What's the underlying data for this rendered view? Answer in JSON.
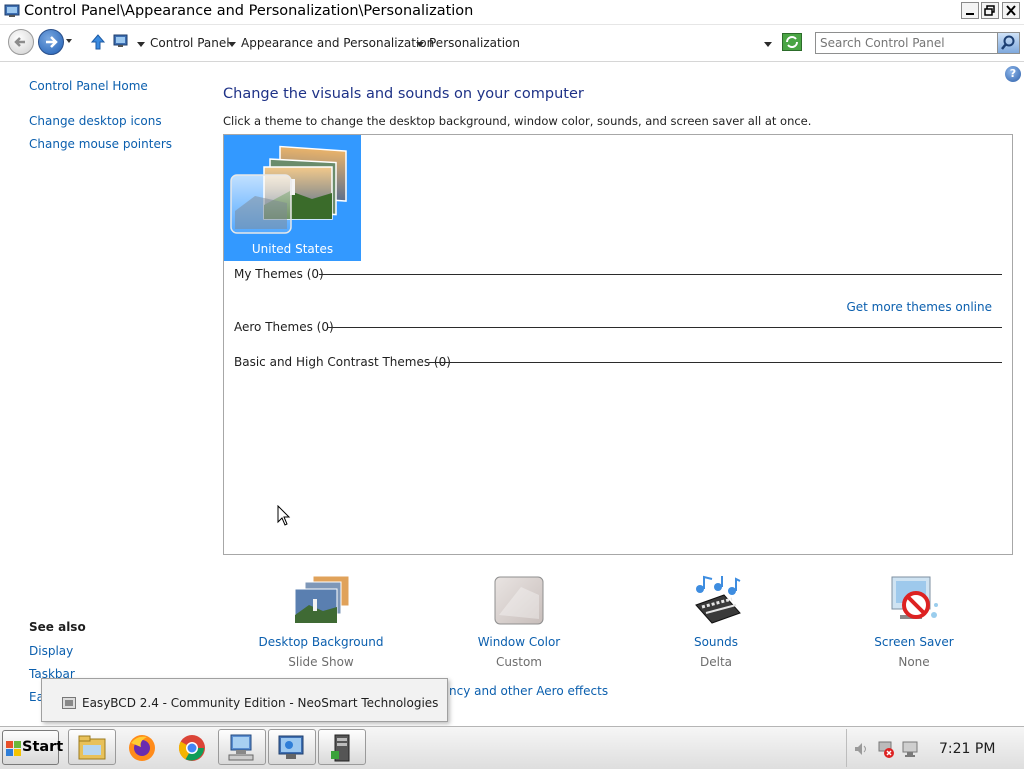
{
  "window": {
    "title": "Control Panel\\Appearance and Personalization\\Personalization",
    "minimize_icon": "minimize-icon",
    "restore_icon": "restore-icon",
    "close_icon": "close-icon"
  },
  "address": {
    "crumbs": [
      "Control Panel",
      "Appearance and Personalization",
      "Personalization"
    ],
    "search_placeholder": "Search Control Panel"
  },
  "left_pane": {
    "home": "Control Panel Home",
    "links": [
      "Change desktop icons",
      "Change mouse pointers"
    ],
    "see_also_title": "See also",
    "see_also": [
      "Display",
      "Taskbar",
      "Ea"
    ]
  },
  "main": {
    "title": "Change the visuals and sounds on your computer",
    "subtitle": "Click a theme to change the desktop background, window color, sounds, and screen saver all at once.",
    "selected_theme": "United States",
    "groups": {
      "my_themes": "My Themes (0)",
      "aero_themes": "Aero Themes (0)",
      "basic_themes": "Basic and High Contrast Themes (0)"
    },
    "more_themes_link": "Get more themes online"
  },
  "settings": [
    {
      "name": "Desktop Background",
      "value": "Slide Show"
    },
    {
      "name": "Window Color",
      "value": "Custom"
    },
    {
      "name": "Sounds",
      "value": "Delta"
    },
    {
      "name": "Screen Saver",
      "value": "None"
    }
  ],
  "partial_link": "ncy and other Aero effects",
  "tooltip": {
    "text": "EasyBCD 2.4 - Community Edition - NeoSmart Technologies"
  },
  "taskbar": {
    "start_label": "Start",
    "clock": "7:21 PM"
  },
  "colors": {
    "link": "#0b5fae",
    "title": "#1e3287",
    "selection": "#3399ff"
  }
}
